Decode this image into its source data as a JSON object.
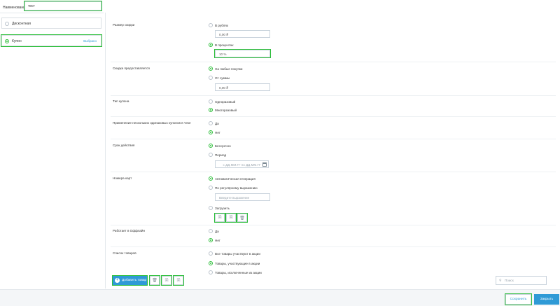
{
  "name": {
    "label": "Наименование",
    "value": "тест"
  },
  "types": [
    {
      "label": "Дисконтная",
      "selected": false,
      "badge": ""
    },
    {
      "label": "Купон",
      "selected": true,
      "badge": "Выбрано"
    }
  ],
  "sections": {
    "discount_size": {
      "label": "Размер скидки",
      "opt_rub": "В рублях",
      "rub_value": "0,00 ₽",
      "opt_pct": "В процентах",
      "pct_value": "10 %"
    },
    "granted": {
      "label": "Скидка предоставляется",
      "opt_any": "На любые покупки",
      "opt_from": "От суммы",
      "from_value": "0,00 ₽"
    },
    "coupon_type": {
      "label": "Тип купона",
      "opt_single": "Одноразовый",
      "opt_multi": "Многоразовый"
    },
    "multi_apply": {
      "label": "Применение нескольких одинаковых купонов в чеке",
      "opt_yes": "Да",
      "opt_no": "Нет"
    },
    "validity": {
      "label": "Срок действия",
      "opt_forever": "Бессрочно",
      "opt_period": "Период",
      "period_placeholder": "с ДД.ММ.ГГ  по ДД.ММ.ГГ"
    },
    "card_numbers": {
      "label": "Номера карт",
      "opt_auto": "Автоматическая генерация",
      "opt_regex": "По регулярному выражению",
      "regex_placeholder": "Введите выражение",
      "opt_upload": "Загрузить"
    },
    "offline": {
      "label": "Работает в Оффлайн",
      "opt_yes": "Да",
      "opt_no": "Нет"
    },
    "products": {
      "label": "Список товаров",
      "opt_all": "Все товары участвуют в акции",
      "opt_included": "Товары, участвующие в акции",
      "opt_excluded": "Товары, исключенные из акции"
    }
  },
  "toolbar": {
    "add_product": "Добавить товар",
    "search_placeholder": "Поиск"
  },
  "footer": {
    "save": "Сохранить",
    "close": "Закрыть"
  },
  "colors": {
    "accent": "#2f9ad6",
    "selected": "#2dbf3a"
  }
}
